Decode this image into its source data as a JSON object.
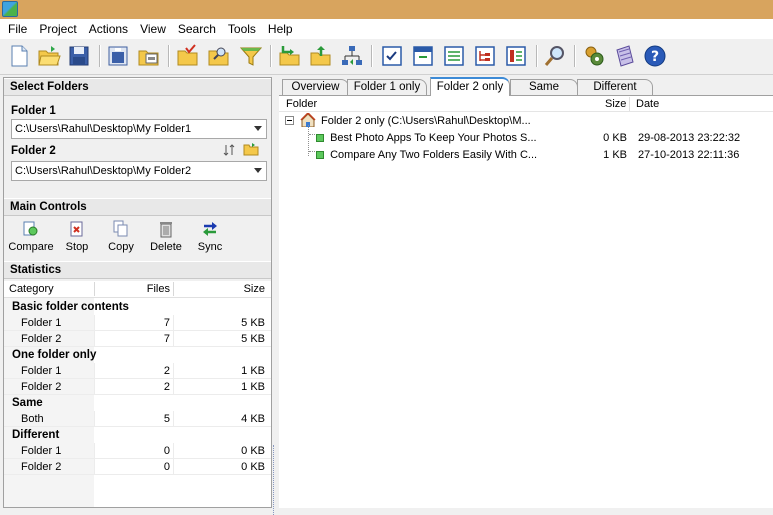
{
  "menu": [
    "File",
    "Project",
    "Actions",
    "View",
    "Search",
    "Tools",
    "Help"
  ],
  "toolbar_icons": [
    "new-project-icon",
    "open-project-icon",
    "save-project-icon",
    "save-as-icon",
    "print-icon",
    "open-folder-icon",
    "search-folder-icon",
    "filter-icon",
    "copy-left-icon",
    "copy-right-icon",
    "sync-tree-icon",
    "checklist-icon",
    "window-icon",
    "list-icon",
    "tree-icon",
    "report-icon",
    "find-icon",
    "plugin-icon",
    "notes-icon",
    "help-icon"
  ],
  "select_folders": {
    "title": "Select Folders",
    "folder1_label": "Folder 1",
    "folder1_value": "C:\\Users\\Rahul\\Desktop\\My Folder1",
    "folder2_label": "Folder 2",
    "folder2_value": "C:\\Users\\Rahul\\Desktop\\My Folder2"
  },
  "main_controls": {
    "title": "Main Controls",
    "buttons": [
      "Compare",
      "Stop",
      "Copy",
      "Delete",
      "Sync"
    ]
  },
  "statistics": {
    "title": "Statistics",
    "headers": [
      "Category",
      "Files",
      "Size"
    ],
    "rows": [
      {
        "type": "group",
        "label": "Basic folder contents",
        "files": "",
        "size": ""
      },
      {
        "type": "item",
        "label": "Folder 1",
        "files": "7",
        "size": "5 KB"
      },
      {
        "type": "item",
        "label": "Folder 2",
        "files": "7",
        "size": "5 KB"
      },
      {
        "type": "group",
        "label": "One folder only",
        "files": "",
        "size": ""
      },
      {
        "type": "item",
        "label": "Folder 1",
        "files": "2",
        "size": "1 KB"
      },
      {
        "type": "item",
        "label": "Folder 2",
        "files": "2",
        "size": "1 KB"
      },
      {
        "type": "group",
        "label": "Same",
        "files": "",
        "size": ""
      },
      {
        "type": "item",
        "label": "Both",
        "files": "5",
        "size": "4 KB"
      },
      {
        "type": "group",
        "label": "Different",
        "files": "",
        "size": ""
      },
      {
        "type": "item",
        "label": "Folder 1",
        "files": "0",
        "size": "0 KB"
      },
      {
        "type": "item",
        "label": "Folder 2",
        "files": "0",
        "size": "0 KB"
      }
    ]
  },
  "tabs": [
    "Overview",
    "Folder 1 only",
    "Folder 2 only",
    "Same",
    "Different"
  ],
  "active_tab": "Folder 2 only",
  "results": {
    "headers": [
      "Folder",
      "Size",
      "Date"
    ],
    "root": "Folder 2 only (C:\\Users\\Rahul\\Desktop\\M...",
    "files": [
      {
        "name": "Best Photo Apps To Keep Your Photos S...",
        "size": "0 KB",
        "date": "29-08-2013 23:22:32"
      },
      {
        "name": "Compare Any Two Folders Easily With C...",
        "size": "1 KB",
        "date": "27-10-2013 22:11:36"
      }
    ]
  },
  "colors": {
    "titlebar": "#d8a45e",
    "accent": "#3c8ad6",
    "status_green": "#5cc85c"
  }
}
